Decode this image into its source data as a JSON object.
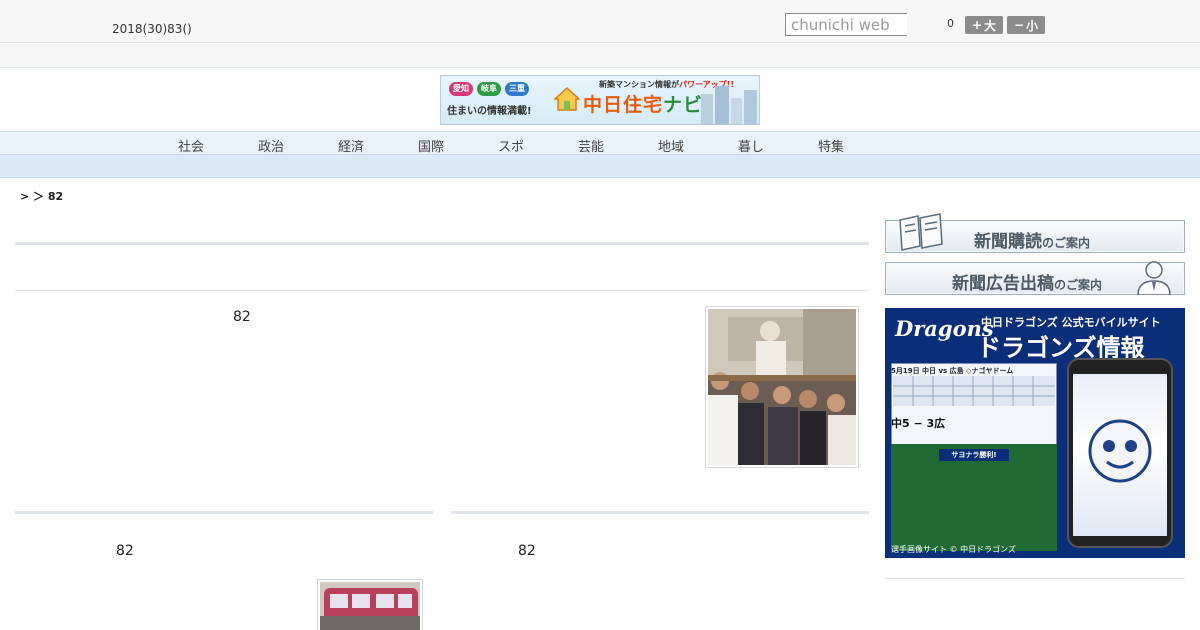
{
  "header": {
    "date": "2018(30)83()",
    "search": {
      "placeholder": "chunichi web"
    },
    "counter": "0",
    "font_larger": {
      "sign": "+",
      "label": "大"
    },
    "font_smaller": {
      "sign": "−",
      "label": "小"
    }
  },
  "banner": {
    "pills": [
      "愛知",
      "岐阜",
      "三重"
    ],
    "tagline": "住まいの情報満載!",
    "brand_a": "中日住宅",
    "brand_b": "ナビ",
    "promo_a": "新築マンション情報が",
    "promo_b": "パワーアップ!!"
  },
  "nav": {
    "items": [
      "社会",
      "政治",
      "経済",
      "国際",
      "スポ",
      "芸能",
      "地域",
      "暮し",
      "特集"
    ]
  },
  "breadcrumb": "> ＞ 82",
  "articles": {
    "main_num": "82",
    "left_num": "82",
    "right_num": "82"
  },
  "sidebar": {
    "subscribe": {
      "main": "新聞購読",
      "suffix": "のご案内"
    },
    "ad": {
      "main": "新聞広告出稿",
      "suffix": "のご案内"
    },
    "dragons": {
      "logo": "Dragons",
      "sub": "中日ドラゴンズ 公式モバイルサイト",
      "title": "ドラゴンズ情報",
      "game": "5月19日 中日 vs 広島 ◇ナゴヤドーム",
      "score": "中5 − 3広",
      "win": "サヨナラ勝利!",
      "foot": "選手画像サイト © 中日ドラゴンズ"
    }
  },
  "colors": {
    "nav_bg": "#e9f2fb",
    "dragons_blue": "#0b2e7a",
    "font_btn": "#8c8c8c"
  }
}
